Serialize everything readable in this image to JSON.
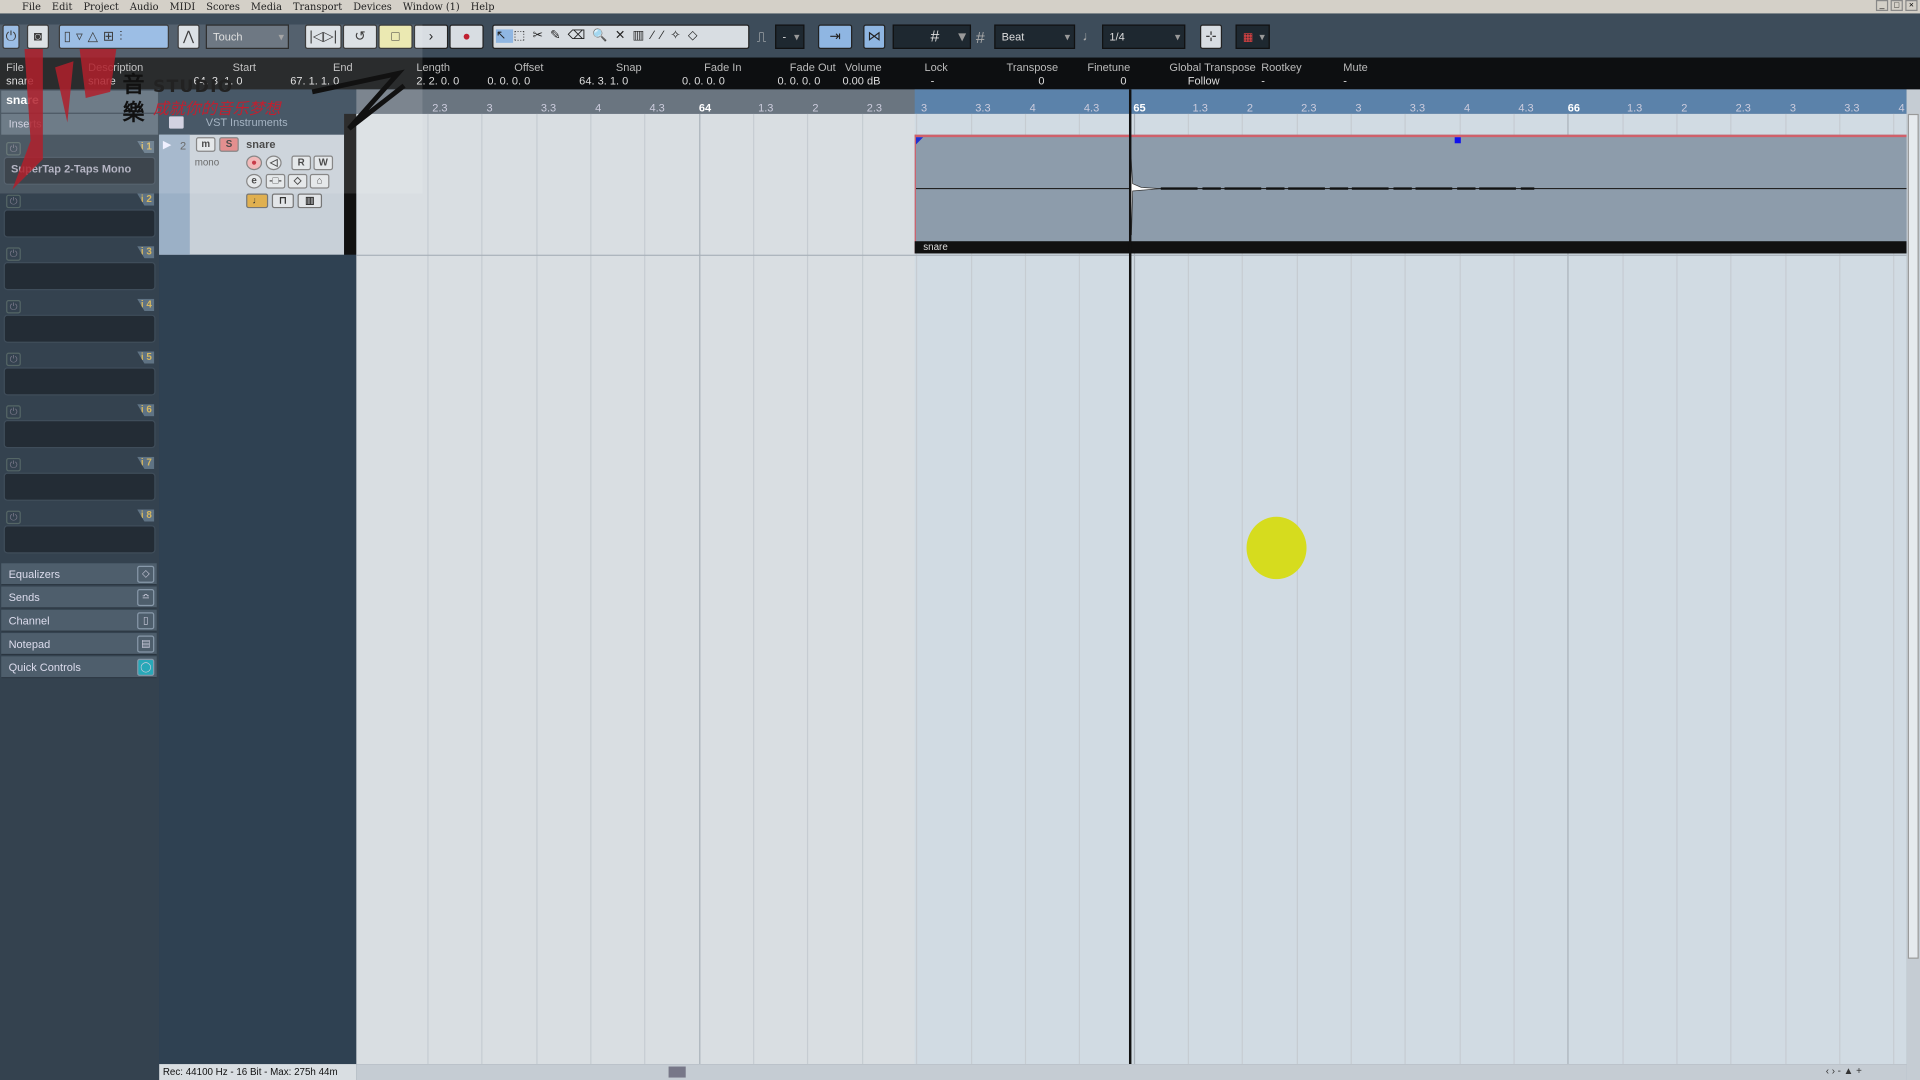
{
  "menu": [
    "File",
    "Edit",
    "Project",
    "Audio",
    "MIDI",
    "Scores",
    "Media",
    "Transport",
    "Devices",
    "Window (1)",
    "Help"
  ],
  "toolbar": {
    "automation_mode": "Touch",
    "quantize_dd": "-",
    "snap_type": "Beat",
    "quantize_value": "1/4"
  },
  "infoline": {
    "headers": [
      "File",
      "Description",
      "Start",
      "End",
      "Length",
      "Offset",
      "Snap",
      "Fade In",
      "Fade Out",
      "Volume",
      "Lock",
      "Transpose",
      "Finetune",
      "Global Transpose",
      "Rootkey",
      "Mute"
    ],
    "values": [
      "snare",
      "snare",
      "64. 3. 1.   0",
      "67. 1. 1.   0",
      "2. 2. 0.   0",
      "0. 0. 0.   0",
      "64. 3. 1.   0",
      "0. 0. 0.   0",
      "0. 0. 0.   0",
      "0.00 dB",
      "-",
      "0",
      "0",
      "Follow",
      "-",
      "-"
    ]
  },
  "inspector": {
    "track_name": "snare",
    "inserts_label": "Inserts",
    "slots": [
      {
        "num": "i 1",
        "plugin": "SuperTap 2-Taps Mono"
      },
      {
        "num": "i 2",
        "plugin": ""
      },
      {
        "num": "i 3",
        "plugin": ""
      },
      {
        "num": "i 4",
        "plugin": ""
      },
      {
        "num": "i 5",
        "plugin": ""
      },
      {
        "num": "i 6",
        "plugin": ""
      },
      {
        "num": "i 7",
        "plugin": ""
      },
      {
        "num": "i 8",
        "plugin": ""
      }
    ],
    "sections": [
      "Equalizers",
      "Sends",
      "Channel",
      "Notepad",
      "Quick Controls"
    ]
  },
  "tracks": {
    "folder": "VST Instruments",
    "track": {
      "number": "2",
      "name": "snare",
      "channel": "mono",
      "mute": "m",
      "solo": "S",
      "read": "R",
      "write": "W"
    }
  },
  "ruler": {
    "labels": [
      "2.3",
      "3",
      "3.3",
      "4",
      "4.3",
      "64",
      "1.3",
      "2",
      "2.3",
      "3",
      "3.3",
      "4",
      "4.3",
      "65",
      "1.3",
      "2",
      "2.3",
      "3",
      "3.3",
      "4",
      "4.3",
      "66",
      "1.3",
      "2",
      "2.3",
      "3",
      "3.3",
      "4"
    ]
  },
  "event": {
    "name": "snare"
  },
  "status": "Rec: 44100 Hz - 16 Bit - Max: 275h 44m",
  "watermark": {
    "text": "小洋 音樂 STUDIO 成就你的音乐梦想"
  },
  "colors": {
    "event_border": "#d0606a",
    "loop_range": "#5b82aa",
    "click_indicator": "#d6dc1e"
  }
}
